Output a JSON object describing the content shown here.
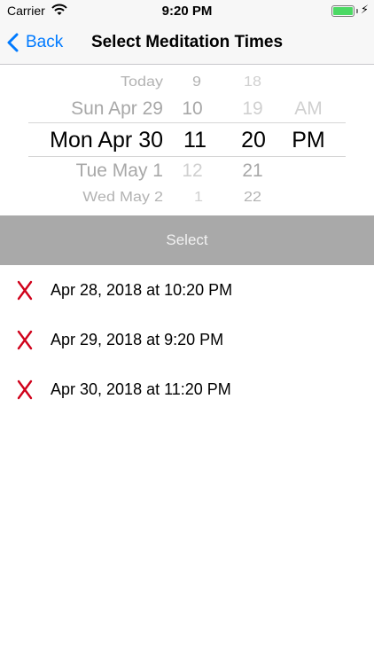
{
  "status_bar": {
    "carrier": "Carrier",
    "time": "9:20 PM",
    "wifi_icon": "wifi-icon",
    "battery_level": 1.0,
    "battery_color": "#4cd964",
    "charging_icon": "lightning-bolt-icon"
  },
  "nav": {
    "back_label": "Back",
    "back_icon": "chevron-left-icon",
    "title": "Select Meditation Times",
    "accent_color": "#007aff"
  },
  "picker": {
    "dates": [
      "Today",
      "Sun Apr 29",
      "Mon Apr 30",
      "Tue May 1",
      "Wed May 2"
    ],
    "hours": [
      "9",
      "10",
      "11",
      "12",
      "1"
    ],
    "minutes": [
      "18",
      "19",
      "20",
      "21",
      "22"
    ],
    "periods": [
      "AM",
      "PM"
    ],
    "selected": {
      "date": "Mon Apr 30",
      "hour": "11",
      "minute": "20",
      "period": "PM"
    }
  },
  "select_button": {
    "label": "Select"
  },
  "times": [
    {
      "text": "Apr 28, 2018 at 10:20 PM",
      "delete_icon": "x-icon"
    },
    {
      "text": "Apr 29, 2018 at 9:20 PM",
      "delete_icon": "x-icon"
    },
    {
      "text": "Apr 30, 2018 at 11:20 PM",
      "delete_icon": "x-icon"
    }
  ],
  "colors": {
    "delete": "#d0021b",
    "select_bar": "#a9a9a9"
  }
}
